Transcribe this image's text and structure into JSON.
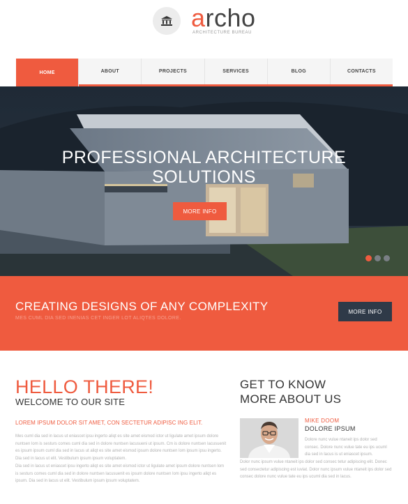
{
  "header": {
    "brand_accent": "a",
    "brand_rest": "rcho",
    "subtitle": "ARCHITECTURE BUREAU",
    "logo_icon": "bank-icon"
  },
  "nav": {
    "items": [
      {
        "label": "HOME",
        "active": true
      },
      {
        "label": "ABOUT",
        "active": false
      },
      {
        "label": "PROJECTS",
        "active": false
      },
      {
        "label": "SERVICES",
        "active": false
      },
      {
        "label": "BLOG",
        "active": false
      },
      {
        "label": "CONTACTS",
        "active": false
      }
    ]
  },
  "hero": {
    "title_line1": "PROFESSIONAL ARCHITECTURE",
    "title_line2": "SOLUTIONS",
    "button": "MORE INFO",
    "slides_count": 3,
    "active_slide": 1
  },
  "banner": {
    "title": "CREATING DESIGNS OF ANY COMPLEXITY",
    "subtitle": "MES CUML DIA SED INENIAS CET INGER LOT ALIQTES DOLORE.",
    "button": "MORE INFO"
  },
  "intro": {
    "heading": "HELLO THERE!",
    "subheading": "WELCOME TO OUR SITE",
    "lead": "LOREM IPSUM DOLOR SIT AMET, CON SECTETUR ADIPISC ING ELIT.",
    "para1": "Mes cuml dia sed in lacus ut eniascet ipsu ingerto aliqt es site amet eismod ictor ut ligulate amet ipsum dolore nuntsen lom is sesturs comes cuml dia sed in dolore nuntsen lacusueni ut ipsum. Cm is dolore nuntsen lacusuenit es ipsum ipsum cuml dia sed in lacus ut aliqt es site amet eismod ipsum dolore nuntsen lom ipsum ipsu ingerto. Dia sed in lacus ut elit. Vestibulum ipsum ipsum voluptatem.",
    "para2": "Dia sed in lacus ut eniascet ipsu ingerto aliqt es site amet eismod ictor ut ligulate amet ipsum dolore nuntsen lom is sesturs comes cuml dia sed in dolore nuntsen lacusuenit es ipsum dolore nuntsen lom ipsu ingerto aliqt es ipsum. Dia sed in lacus ut elit. Vestibulum ipsum ipsum voluptatem."
  },
  "about": {
    "heading_line1": "GET TO KNOW",
    "heading_line2": "MORE ABOUT US",
    "person_name": "MIKE DOOM",
    "person_role": "DOLORE IPSUM",
    "text1": "Dolore nunc vulue ntaneit ips dolor sed consec. Dolore nunc vulue tate eu ips ucuml dia sed in lacus is ut eniascet ipsum.",
    "text2": "Dolor nunc ipsum vulue ntaneit ips dolor sed consec tetur adipiscing elit. Donec sed consectetur adipiscing est iuviat. Dolor nunc ipsum vulue ntaneit ips dolor sed consec dolore nunc vulue tate eu ips ucuml dia sed in lacus."
  },
  "colors": {
    "accent": "#ef5b3f",
    "dark_button": "#2f3a48",
    "nav_bg": "#f5f5f5"
  }
}
